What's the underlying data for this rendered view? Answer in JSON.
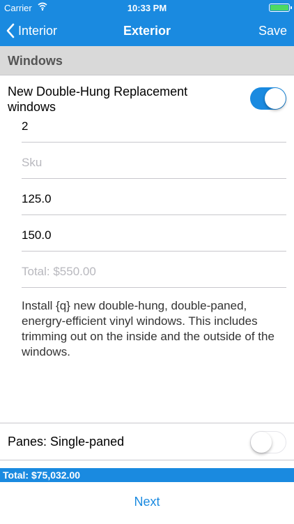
{
  "status_bar": {
    "carrier": "Carrier",
    "time": "10:33 PM",
    "battery_color": "#4cd964"
  },
  "nav": {
    "back_label": "Interior",
    "title": "Exterior",
    "save_label": "Save",
    "bar_color": "#1a8ae0"
  },
  "section": {
    "header": "Windows"
  },
  "item": {
    "title": "New Double-Hung Replacement windows",
    "enabled": true,
    "quantity": "2",
    "sku_placeholder": "Sku",
    "sku_value": "",
    "field_3": "125.0",
    "field_4": "150.0",
    "total_placeholder": "Total: $550.00",
    "description": "Install {q} new double-hung, double-paned, energry-efficient vinyl windows.  This includes trimming out on the inside and the outside of the windows."
  },
  "panes": {
    "label": "Panes: Single-paned",
    "enabled": false
  },
  "footer": {
    "total": "Total: $75,032.00",
    "next_label": "Next"
  }
}
